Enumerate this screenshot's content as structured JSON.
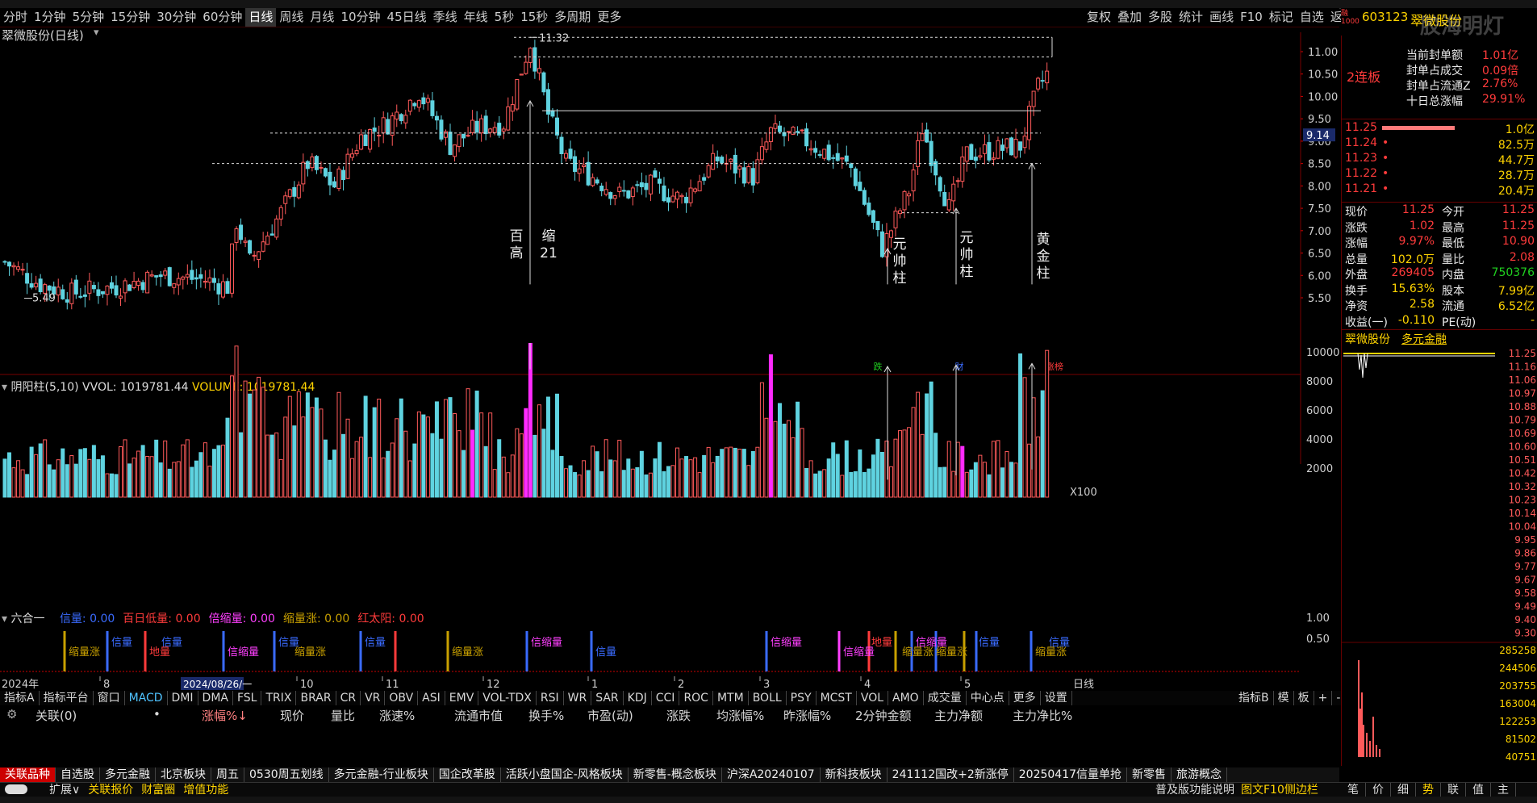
{
  "periods": [
    "分时",
    "1分钟",
    "5分钟",
    "15分钟",
    "30分钟",
    "60分钟",
    "日线",
    "周线",
    "月线",
    "10分钟",
    "45日线",
    "季线",
    "年线",
    "5秒",
    "15秒",
    "多周期",
    "更多"
  ],
  "active_period": "日线",
  "toolbar_buttons": [
    "复权",
    "叠加",
    "多股",
    "统计",
    "画线",
    "F10",
    "标记",
    "自选",
    "返回"
  ],
  "stock": {
    "code": "603123",
    "name": "翠微股份",
    "watermark": "胶海明灯",
    "title": "翠微股份(日线)",
    "streak": "2连板"
  },
  "seal_stats": [
    {
      "label": "当前封单额",
      "value": "1.01亿"
    },
    {
      "label": "封单占成交",
      "value": "0.09倍"
    },
    {
      "label": "封单占流通Z",
      "value": "2.76%"
    },
    {
      "label": "十日总涨幅",
      "value": "29.91%"
    }
  ],
  "order_book": [
    {
      "price": "11.25",
      "dot": "",
      "vol": "1.0亿",
      "bar": 1.0
    },
    {
      "price": "11.24",
      "dot": "•",
      "vol": "82.5万",
      "bar": 0
    },
    {
      "price": "11.23",
      "dot": "•",
      "vol": "44.7万",
      "bar": 0
    },
    {
      "price": "11.22",
      "dot": "•",
      "vol": "28.7万",
      "bar": 0
    },
    {
      "price": "11.21",
      "dot": "•",
      "vol": "20.4万",
      "bar": 0
    }
  ],
  "quote_rows": [
    [
      {
        "t": "现价",
        "c": "wht"
      },
      {
        "t": "11.25",
        "c": "red"
      },
      {
        "t": "今开",
        "c": "wht"
      },
      {
        "t": "11.25",
        "c": "red"
      }
    ],
    [
      {
        "t": "涨跌",
        "c": "wht"
      },
      {
        "t": "1.02",
        "c": "red"
      },
      {
        "t": "最高",
        "c": "wht"
      },
      {
        "t": "11.25",
        "c": "red"
      }
    ],
    [
      {
        "t": "涨幅",
        "c": "wht"
      },
      {
        "t": "9.97%",
        "c": "red"
      },
      {
        "t": "最低",
        "c": "wht"
      },
      {
        "t": "10.90",
        "c": "red"
      }
    ],
    [
      {
        "t": "总量",
        "c": "wht"
      },
      {
        "t": "102.0万",
        "c": "yel"
      },
      {
        "t": "量比",
        "c": "wht"
      },
      {
        "t": "2.08",
        "c": "red"
      }
    ],
    [
      {
        "t": "外盘",
        "c": "wht"
      },
      {
        "t": "269405",
        "c": "red"
      },
      {
        "t": "内盘",
        "c": "wht"
      },
      {
        "t": "750376",
        "c": "green"
      }
    ],
    [
      {
        "t": "换手",
        "c": "wht"
      },
      {
        "t": "15.63%",
        "c": "yel"
      },
      {
        "t": "股本",
        "c": "wht"
      },
      {
        "t": "7.99亿",
        "c": "yel"
      }
    ],
    [
      {
        "t": "净资",
        "c": "wht"
      },
      {
        "t": "2.58",
        "c": "yel"
      },
      {
        "t": "流通",
        "c": "wht"
      },
      {
        "t": "6.52亿",
        "c": "yel"
      }
    ],
    [
      {
        "t": "收益(一)",
        "c": "wht"
      },
      {
        "t": "-0.110",
        "c": "yel"
      },
      {
        "t": "PE(动)",
        "c": "wht"
      },
      {
        "t": "-",
        "c": "yel"
      }
    ]
  ],
  "mini_header": {
    "name": "翠微股份",
    "concept": "多元金融"
  },
  "mini_axis": [
    "11.25",
    "11.16",
    "11.06",
    "10.97",
    "10.88",
    "10.79",
    "10.69",
    "10.60",
    "10.51",
    "10.42",
    "10.32",
    "10.23",
    "10.14",
    "10.04",
    "9.95",
    "9.86",
    "9.77",
    "9.67",
    "9.58",
    "9.49",
    "9.40",
    "9.30"
  ],
  "mini_vol_axis": [
    "285258",
    "244506",
    "203755",
    "163004",
    "122253",
    "81502",
    "40751"
  ],
  "price_axis": [
    "11.00",
    "10.50",
    "10.00",
    "9.50",
    "9.00",
    "8.50",
    "8.00",
    "7.50",
    "7.00",
    "6.50",
    "6.00",
    "5.50"
  ],
  "price_tag": "9.14",
  "high_label": "11.32",
  "low_label": "5.49",
  "annotations": [
    {
      "text": "百\n高"
    },
    {
      "text": "缩\n21"
    },
    {
      "text": "元\n帅\n柱"
    },
    {
      "text": "元\n帅\n柱"
    },
    {
      "text": "黄\n金\n柱"
    }
  ],
  "event_tags": [
    "跌",
    "财",
    "涨榜"
  ],
  "vol_indicator": {
    "name": "阴阳柱(5,10)",
    "vvol": "VVOL: 1019781.44",
    "volume": "VOLUME: 1019781.44",
    "axis": [
      "10000",
      "8000",
      "6000",
      "4000",
      "2000"
    ],
    "unit": "X100"
  },
  "liuheyi": {
    "name": "六合一",
    "items": [
      {
        "t": "信量: 0.00",
        "c": "#3a6bff"
      },
      {
        "t": "百日低量: 0.00",
        "c": "#ff3b3b"
      },
      {
        "t": "倍缩量: 0.00",
        "c": "#ff40ff"
      },
      {
        "t": "缩量涨: 0.00",
        "c": "#c8a000"
      },
      {
        "t": "红太阳: 0.00",
        "c": "#ff3b3b"
      }
    ],
    "axis": [
      "1.00",
      "0.50"
    ],
    "labels": [
      "缩量涨",
      "信量",
      "地量",
      "信量",
      "信缩量",
      "信量",
      "缩量涨",
      "信量",
      "缩量涨",
      "信缩量",
      "信量",
      "信缩量",
      "信缩量",
      "地量",
      "缩量涨",
      "信缩量",
      "缩量涨",
      "信量",
      "缩量涨",
      "信量"
    ]
  },
  "date_axis": {
    "year": "2024年",
    "cursor": "2024/08/26/一",
    "months": [
      "8",
      "10",
      "11",
      "12",
      "1",
      "2",
      "3",
      "4",
      "5"
    ],
    "period": "日线"
  },
  "indicator_tabs": [
    "指标A",
    "指标平台",
    "窗口",
    "MACD",
    "DMI",
    "DMA",
    "FSL",
    "TRIX",
    "BRAR",
    "CR",
    "VR",
    "OBV",
    "ASI",
    "EMV",
    "VOL-TDX",
    "RSI",
    "WR",
    "SAR",
    "KDJ",
    "CCI",
    "ROC",
    "MTM",
    "BOLL",
    "PSY",
    "MCST",
    "VOL",
    "AMO",
    "成交量",
    "中心点",
    "更多",
    "设置"
  ],
  "indicator_tabs_right": [
    "指标B",
    "模",
    "板",
    "+",
    "-"
  ],
  "list_columns": [
    "关联(0)",
    "•",
    "涨幅%↓",
    "现价",
    "量比",
    "涨速%",
    "流通市值",
    "换手%",
    "市盈(动)",
    "涨跌",
    "均涨幅%",
    "昨涨幅%",
    "2分钟金额",
    "主力净额",
    "主力净比%"
  ],
  "bottom_tabs": [
    "关联品种",
    "自选股",
    "多元金融",
    "北京板块",
    "周五",
    "0530周五划线",
    "多元金融-行业板块",
    "国企改革股",
    "活跃小盘国企-风格板块",
    "新零售-概念板块",
    "沪深A20240107",
    "新科技板块",
    "241112国改+2新涨停",
    "20250417信量单抢",
    "新零售",
    "旅游概念"
  ],
  "footer_left": [
    "扩展∨",
    "关联报价",
    "财富圈",
    "增值功能"
  ],
  "footer_right": [
    "普及版功能说明",
    "图文F10侧边栏"
  ],
  "footer_icons": [
    "笔",
    "价",
    "细",
    "势",
    "联",
    "值",
    "主"
  ],
  "colors": {
    "up": "#ff5a5a",
    "down": "#5fd3e0",
    "magenta": "#ff2bff",
    "grid": "#600000"
  }
}
